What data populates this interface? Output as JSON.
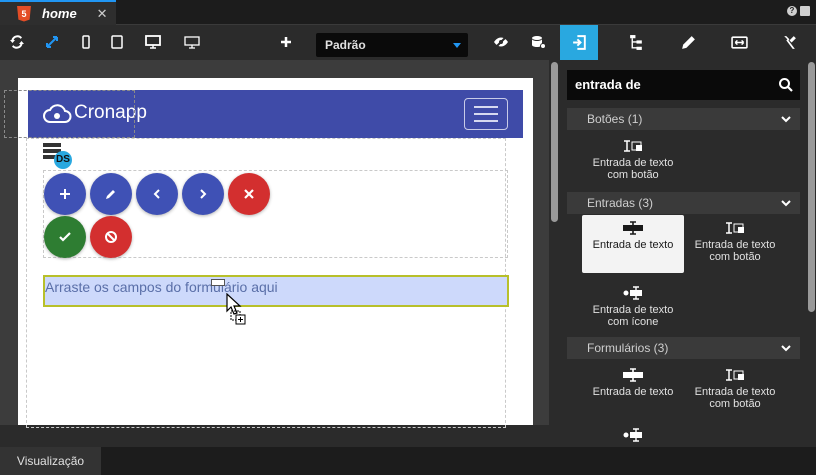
{
  "tab": {
    "title": "home",
    "close": "✕",
    "badge": "5"
  },
  "toolbar": {
    "profile": "Padrão"
  },
  "canvas": {
    "brand": "Cronapp",
    "datasource_badge": "DS",
    "dropzone_text": "Arraste os campos do formulário aqui"
  },
  "palette": {
    "search_value": "entrada de",
    "categories": [
      {
        "label": "Botões (1)"
      },
      {
        "label": "Entradas (3)"
      },
      {
        "label": "Formulários (3)"
      }
    ],
    "items": {
      "botoes_0": "Entrada de texto com botão",
      "entradas_0": "Entrada de texto",
      "entradas_1": "Entrada de texto com botão",
      "entradas_2": "Entrada de texto com ícone",
      "form_0": "Entrada de texto",
      "form_1": "Entrada de texto com botão"
    }
  },
  "bottom": {
    "tab_label": "Visualização"
  },
  "colors": {
    "accent": "#29a8e0",
    "navbar": "#3f4ba8",
    "fab_blue": "#3f51b5",
    "fab_red": "#d32f2f",
    "fab_green": "#2e7d32"
  }
}
